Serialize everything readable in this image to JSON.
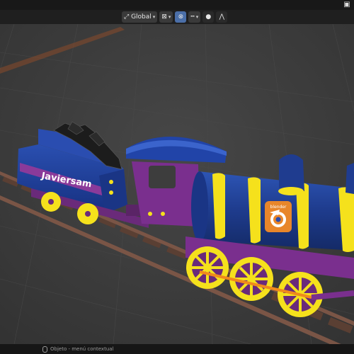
{
  "header": {
    "orientation_label": "Global",
    "orientation_icon": "transform-orientation-icon",
    "pivot_icon": "pivot-point-icon",
    "snap_icon": "snap-icon",
    "snap_target_icon": "snap-target-icon",
    "proportional_edit_icon": "proportional-editing-icon",
    "falloff_icon": "falloff-curve-icon",
    "top_right_icon": "view-icon"
  },
  "scene": {
    "tender_text": "Javiersam",
    "logo_text": "blender",
    "colors": {
      "body_blue": "#1f3c8f",
      "purple": "#7a2f8e",
      "yellow": "#f5e11c",
      "orange": "#f08a1c",
      "rail_brown": "#6b4a3a"
    }
  },
  "statusbar": {
    "hint": "Objeto - menú contextual"
  }
}
